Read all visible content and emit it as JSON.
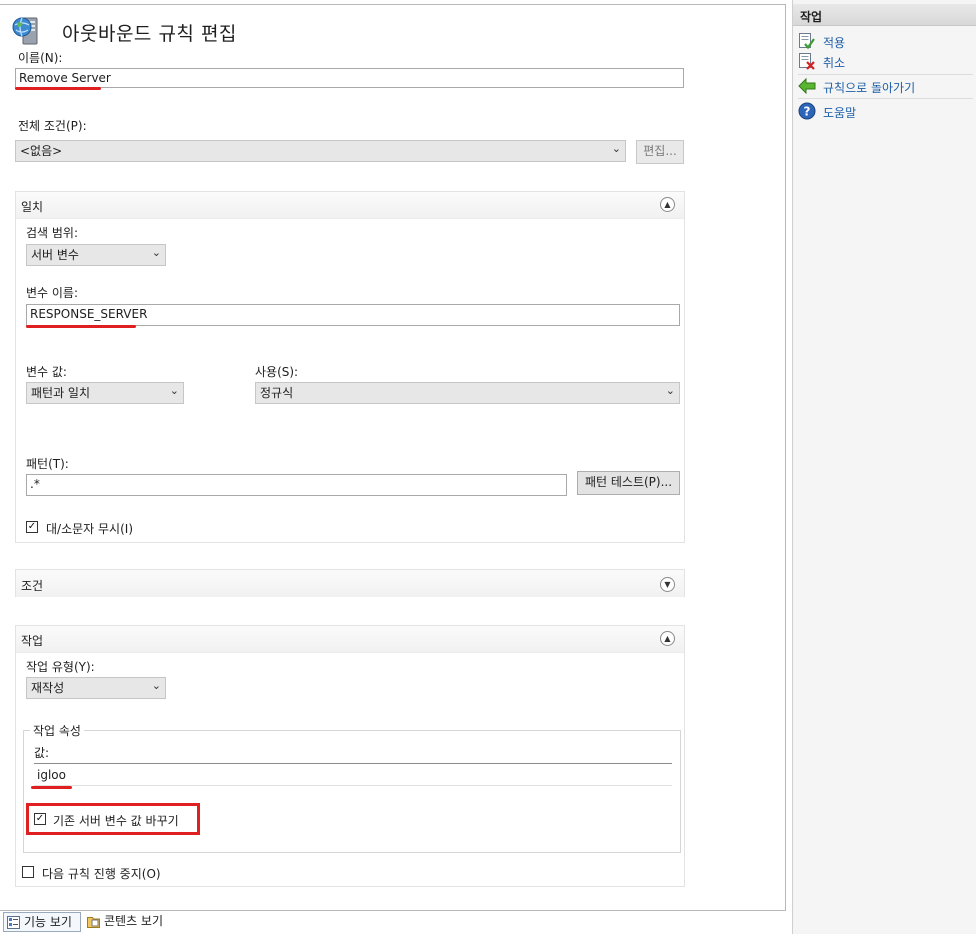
{
  "header": {
    "title": "아웃바운드 규칙 편집"
  },
  "form": {
    "name_label": "이름(N):",
    "name_value": "Remove Server",
    "precondition_label": "전체 조건(P):",
    "precondition_value": "<없음>",
    "edit_button": "편집..."
  },
  "match": {
    "section_title": "일치",
    "scope_label": "검색 범위:",
    "scope_value": "서버 변수",
    "varname_label": "변수 이름:",
    "varname_value": "RESPONSE_SERVER",
    "varvalue_label": "변수 값:",
    "varvalue_value": "패턴과 일치",
    "using_label": "사용(S):",
    "using_value": "정규식",
    "pattern_label": "패턴(T):",
    "pattern_value": ".*",
    "test_button": "패턴 테스트(P)...",
    "ignore_case_label": "대/소문자 무시(I)",
    "ignore_case_checked": true
  },
  "conditions": {
    "section_title": "조건"
  },
  "action": {
    "section_title": "작업",
    "type_label": "작업 유형(Y):",
    "type_value": "재작성",
    "props_legend": "작업 속성",
    "value_label": "값:",
    "value_value": "igloo",
    "replace_label": "기존 서버 변수 값 바꾸기",
    "replace_checked": true,
    "stop_label": "다음 규칙 진행 중지(O)",
    "stop_checked": false
  },
  "sidebar": {
    "title": "작업",
    "items": [
      {
        "label": "적용",
        "icon": "apply-icon"
      },
      {
        "label": "취소",
        "icon": "cancel-icon"
      },
      {
        "label": "규칙으로 돌아가기",
        "icon": "back-arrow-icon"
      },
      {
        "label": "도움말",
        "icon": "help-icon"
      }
    ]
  },
  "bottom_tabs": [
    {
      "label": "기능 보기",
      "active": true
    },
    {
      "label": "콘텐츠 보기",
      "active": false
    }
  ],
  "colors": {
    "accent_red": "#e02020",
    "link_blue": "#1f5fa8"
  }
}
